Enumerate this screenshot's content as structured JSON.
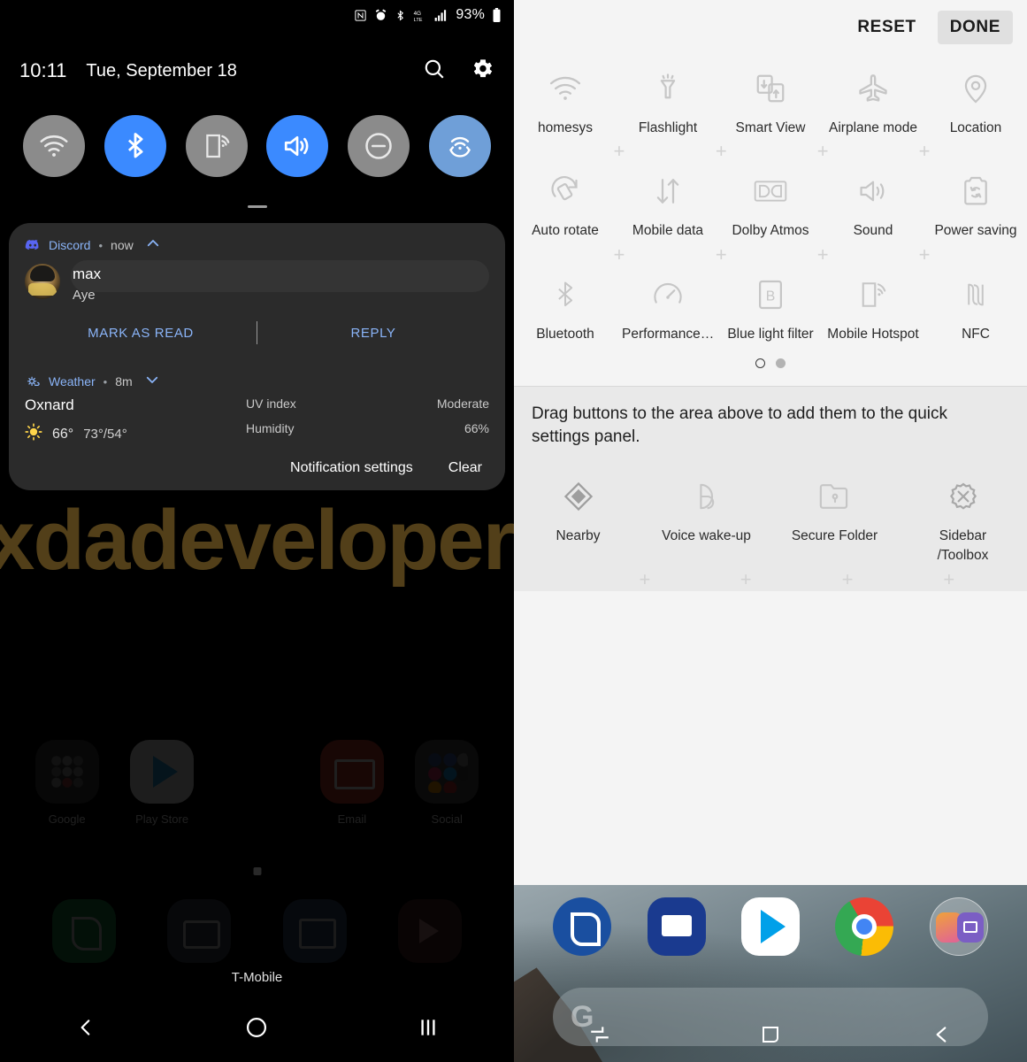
{
  "left_phone": {
    "status_bar": {
      "icons": [
        "nfc-icon",
        "alarm-icon",
        "bluetooth-icon",
        "4g-lte-icon",
        "signal-bars-icon"
      ],
      "battery_text": "93%",
      "battery_icon": "battery-full-icon"
    },
    "shade": {
      "time": "10:11",
      "date": "Tue, September 18",
      "search_icon": "search-icon",
      "settings_icon": "gear-icon",
      "toggles": [
        {
          "name": "wifi-toggle",
          "icon": "wifi-icon",
          "state": "off"
        },
        {
          "name": "bluetooth-toggle",
          "icon": "bluetooth-icon",
          "state": "on"
        },
        {
          "name": "smartview-toggle",
          "icon": "smart-view-icon",
          "state": "off"
        },
        {
          "name": "sound-toggle",
          "icon": "sound-icon",
          "state": "on"
        },
        {
          "name": "dnd-toggle",
          "icon": "do-not-disturb-icon",
          "state": "off"
        },
        {
          "name": "hotspot-toggle",
          "icon": "mobile-hotspot-icon",
          "state": "on-light"
        }
      ]
    },
    "notifications": [
      {
        "app": "Discord",
        "separator": "•",
        "time": "now",
        "collapse_icon": "chevron-up-icon",
        "title": "max",
        "message": "Aye",
        "actions": [
          "MARK AS READ",
          "REPLY"
        ]
      },
      {
        "app": "Weather",
        "separator": "•",
        "time": "8m",
        "collapse_icon": "chevron-down-icon",
        "city": "Oxnard",
        "weather_icon": "sun-icon",
        "current_temp": "66°",
        "range_temp": "73°/54°",
        "details": [
          {
            "label": "UV index",
            "value": "Moderate"
          },
          {
            "label": "Humidity",
            "value": "66%"
          }
        ]
      }
    ],
    "shade_footer": {
      "notification_settings": "Notification settings",
      "clear": "Clear"
    },
    "watermark": "xdadevelopers",
    "home_screen": {
      "apps": [
        {
          "label": "Google",
          "icon": "google-folder-icon"
        },
        {
          "label": "Play Store",
          "icon": "play-store-icon"
        },
        {
          "label": "",
          "icon": "blank-icon"
        },
        {
          "label": "Email",
          "icon": "email-icon"
        },
        {
          "label": "Social",
          "icon": "social-folder-icon"
        }
      ],
      "dock": [
        "phone-icon",
        "camera-icon",
        "gallery-icon",
        "store-icon"
      ]
    },
    "carrier": "T-Mobile",
    "nav_bar": [
      {
        "name": "back-button",
        "icon": "chevron-left-icon"
      },
      {
        "name": "home-button",
        "icon": "circle-icon"
      },
      {
        "name": "recents-button",
        "icon": "three-bars-icon"
      }
    ]
  },
  "right_phone": {
    "header": {
      "reset_label": "RESET",
      "done_label": "DONE"
    },
    "available_grid": {
      "rows": [
        [
          {
            "label": "homesys",
            "icon": "wifi-icon"
          },
          {
            "label": "Flashlight",
            "icon": "flashlight-icon"
          },
          {
            "label": "Smart View",
            "icon": "smart-view-icon"
          },
          {
            "label": "Airplane mode",
            "icon": "airplane-icon"
          },
          {
            "label": "Location",
            "icon": "location-pin-icon"
          }
        ],
        [
          {
            "label": "Auto rotate",
            "icon": "auto-rotate-icon"
          },
          {
            "label": "Mobile data",
            "icon": "mobile-data-icon"
          },
          {
            "label": "Dolby Atmos",
            "icon": "dolby-atmos-icon"
          },
          {
            "label": "Sound",
            "icon": "sound-icon"
          },
          {
            "label": "Power saving",
            "icon": "power-saving-icon"
          }
        ],
        [
          {
            "label": "Bluetooth",
            "icon": "bluetooth-icon"
          },
          {
            "label": "Performance…",
            "icon": "performance-icon"
          },
          {
            "label": "Blue light filter",
            "icon": "blue-light-filter-icon"
          },
          {
            "label": "Mobile Hotspot",
            "icon": "mobile-hotspot-icon"
          },
          {
            "label": "NFC",
            "icon": "nfc-icon"
          }
        ]
      ],
      "page_dots": [
        {
          "state": "current"
        },
        {
          "state": "other"
        }
      ]
    },
    "drag_hint": "Drag buttons to the area above to add them to the quick settings panel.",
    "extra_row": [
      {
        "label": "Nearby",
        "icon": "nearby-share-icon"
      },
      {
        "label": "Voice wake-up",
        "icon": "bixby-voice-icon"
      },
      {
        "label": "Secure Folder",
        "icon": "secure-folder-icon"
      },
      {
        "label": "Sidebar /Toolbox",
        "icon": "sidebar-toolbox-icon"
      }
    ],
    "home_dock": [
      {
        "name": "phone-app",
        "icon": "phone-icon"
      },
      {
        "name": "messages-app",
        "icon": "messages-icon"
      },
      {
        "name": "play-store-app",
        "icon": "play-store-icon"
      },
      {
        "name": "chrome-app",
        "icon": "chrome-icon"
      },
      {
        "name": "camera-folder",
        "icon": "camera-folder-icon"
      }
    ],
    "search_bar": {
      "logo": "G"
    },
    "nav_bar": [
      {
        "name": "recents-button",
        "icon": "recents-icon"
      },
      {
        "name": "home-button",
        "icon": "square-home-icon"
      },
      {
        "name": "back-button",
        "icon": "arrow-left-icon"
      }
    ]
  },
  "colors": {
    "accent_blue": "#3b8aff",
    "accent_blue_light": "#6f9fd8",
    "toggle_off": "#8b8b8b",
    "notif_link": "#8ab4f8",
    "panel_top_bg": "#f4f4f4",
    "panel_bottom_bg": "#e9e9e9"
  }
}
